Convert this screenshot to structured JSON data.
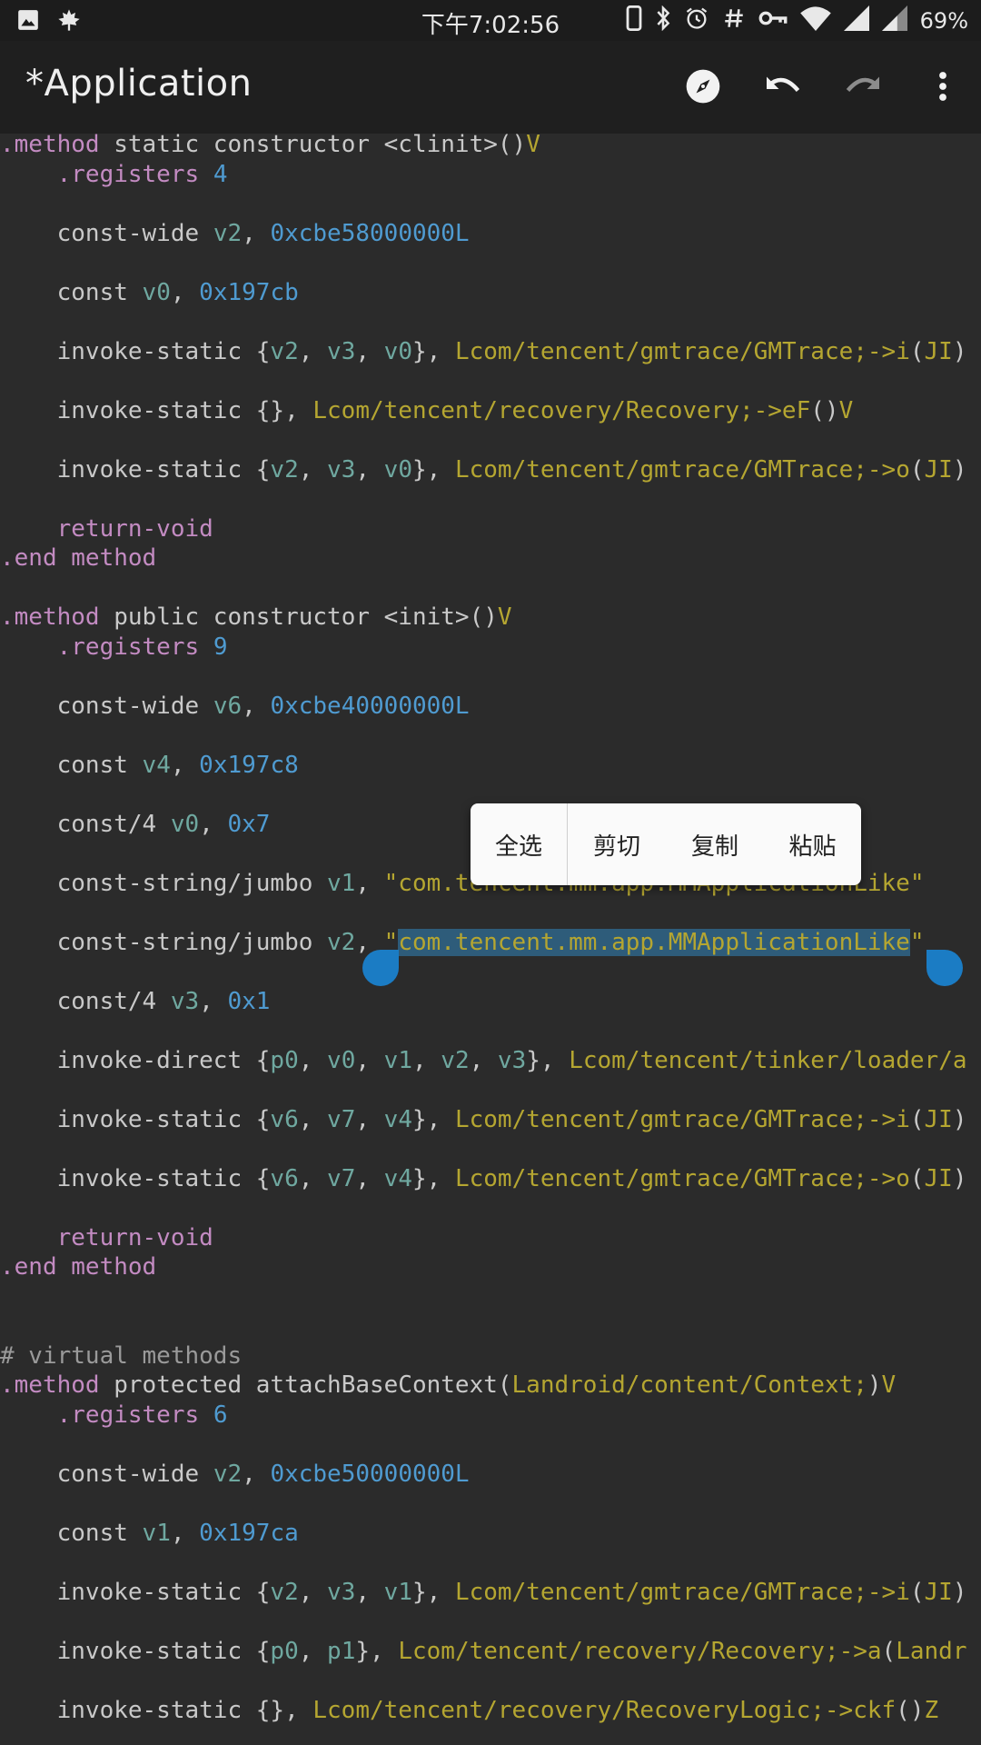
{
  "status_bar": {
    "time": "下午7:02:56",
    "battery": "69%",
    "left_icons": [
      "image-icon",
      "maple-leaf-icon"
    ],
    "right_icons": [
      "phone-icon",
      "bluetooth-icon",
      "alarm-icon",
      "hash-icon",
      "vpn-key-icon",
      "wifi-icon",
      "signal-icon",
      "signal-icon"
    ]
  },
  "app_bar": {
    "title": "*Application",
    "actions": [
      "compass-icon",
      "undo-icon",
      "redo-icon",
      "more-vert-icon"
    ]
  },
  "context_menu": {
    "items": [
      "全选",
      "剪切",
      "复制",
      "粘贴"
    ]
  },
  "code_lines": [
    [
      [
        ".method ",
        "kw"
      ],
      [
        "static constructor <clinit>()",
        "plain"
      ],
      [
        "V",
        "type"
      ]
    ],
    [
      [
        "    .registers ",
        "kw"
      ],
      [
        "4",
        "num"
      ]
    ],
    [],
    [
      [
        "    const-wide ",
        "plain"
      ],
      [
        "v2",
        "reg"
      ],
      [
        ", ",
        "plain"
      ],
      [
        "0xcbe58000000L",
        "num"
      ]
    ],
    [],
    [
      [
        "    const ",
        "plain"
      ],
      [
        "v0",
        "reg"
      ],
      [
        ", ",
        "plain"
      ],
      [
        "0x197cb",
        "num"
      ]
    ],
    [],
    [
      [
        "    invoke-static {",
        "plain"
      ],
      [
        "v2",
        "reg"
      ],
      [
        ", ",
        "plain"
      ],
      [
        "v3",
        "reg"
      ],
      [
        ", ",
        "plain"
      ],
      [
        "v0",
        "reg"
      ],
      [
        "}, ",
        "plain"
      ],
      [
        "Lcom/tencent/gmtrace/GMTrace;->i",
        "type"
      ],
      [
        "(",
        "plain"
      ],
      [
        "JI",
        "type"
      ],
      [
        ")",
        "plain"
      ]
    ],
    [],
    [
      [
        "    invoke-static {}, ",
        "plain"
      ],
      [
        "Lcom/tencent/recovery/Recovery;->eF",
        "type"
      ],
      [
        "()",
        "plain"
      ],
      [
        "V",
        "type"
      ]
    ],
    [],
    [
      [
        "    invoke-static {",
        "plain"
      ],
      [
        "v2",
        "reg"
      ],
      [
        ", ",
        "plain"
      ],
      [
        "v3",
        "reg"
      ],
      [
        ", ",
        "plain"
      ],
      [
        "v0",
        "reg"
      ],
      [
        "}, ",
        "plain"
      ],
      [
        "Lcom/tencent/gmtrace/GMTrace;->o",
        "type"
      ],
      [
        "(",
        "plain"
      ],
      [
        "JI",
        "type"
      ],
      [
        ")",
        "plain"
      ]
    ],
    [],
    [
      [
        "    return-void",
        "kw"
      ]
    ],
    [
      [
        ".end method",
        "kw"
      ]
    ],
    [],
    [
      [
        ".method ",
        "kw"
      ],
      [
        "public constructor <init>()",
        "plain"
      ],
      [
        "V",
        "type"
      ]
    ],
    [
      [
        "    .registers ",
        "kw"
      ],
      [
        "9",
        "num"
      ]
    ],
    [],
    [
      [
        "    const-wide ",
        "plain"
      ],
      [
        "v6",
        "reg"
      ],
      [
        ", ",
        "plain"
      ],
      [
        "0xcbe40000000L",
        "num"
      ]
    ],
    [],
    [
      [
        "    const ",
        "plain"
      ],
      [
        "v4",
        "reg"
      ],
      [
        ", ",
        "plain"
      ],
      [
        "0x197c8",
        "num"
      ]
    ],
    [],
    [
      [
        "    const/4 ",
        "plain"
      ],
      [
        "v0",
        "reg"
      ],
      [
        ", ",
        "plain"
      ],
      [
        "0x7",
        "num"
      ]
    ],
    [],
    [
      [
        "    const-string/jumbo ",
        "plain"
      ],
      [
        "v1",
        "reg"
      ],
      [
        ", ",
        "plain"
      ],
      [
        "\"com.tencent.mm.app.MMApplicationLike\"",
        "str"
      ]
    ],
    [],
    [
      [
        "    const-string/jumbo ",
        "plain"
      ],
      [
        "v2",
        "reg"
      ],
      [
        ", ",
        "plain"
      ],
      [
        "\"",
        "str"
      ],
      [
        "com.tencent.mm.app.MMApplicationLike",
        "str sel"
      ],
      [
        "\"",
        "str"
      ]
    ],
    [],
    [
      [
        "    const/4 ",
        "plain"
      ],
      [
        "v3",
        "reg"
      ],
      [
        ", ",
        "plain"
      ],
      [
        "0x1",
        "num"
      ]
    ],
    [],
    [
      [
        "    invoke-direct {",
        "plain"
      ],
      [
        "p0",
        "reg"
      ],
      [
        ", ",
        "plain"
      ],
      [
        "v0",
        "reg"
      ],
      [
        ", ",
        "plain"
      ],
      [
        "v1",
        "reg"
      ],
      [
        ", ",
        "plain"
      ],
      [
        "v2",
        "reg"
      ],
      [
        ", ",
        "plain"
      ],
      [
        "v3",
        "reg"
      ],
      [
        "}, ",
        "plain"
      ],
      [
        "Lcom/tencent/tinker/loader/a",
        "type"
      ]
    ],
    [],
    [
      [
        "    invoke-static {",
        "plain"
      ],
      [
        "v6",
        "reg"
      ],
      [
        ", ",
        "plain"
      ],
      [
        "v7",
        "reg"
      ],
      [
        ", ",
        "plain"
      ],
      [
        "v4",
        "reg"
      ],
      [
        "}, ",
        "plain"
      ],
      [
        "Lcom/tencent/gmtrace/GMTrace;->i",
        "type"
      ],
      [
        "(",
        "plain"
      ],
      [
        "JI",
        "type"
      ],
      [
        ")",
        "plain"
      ]
    ],
    [],
    [
      [
        "    invoke-static {",
        "plain"
      ],
      [
        "v6",
        "reg"
      ],
      [
        ", ",
        "plain"
      ],
      [
        "v7",
        "reg"
      ],
      [
        ", ",
        "plain"
      ],
      [
        "v4",
        "reg"
      ],
      [
        "}, ",
        "plain"
      ],
      [
        "Lcom/tencent/gmtrace/GMTrace;->o",
        "type"
      ],
      [
        "(",
        "plain"
      ],
      [
        "JI",
        "type"
      ],
      [
        ")",
        "plain"
      ]
    ],
    [],
    [
      [
        "    return-void",
        "kw"
      ]
    ],
    [
      [
        ".end method",
        "kw"
      ]
    ],
    [],
    [],
    [
      [
        "# virtual methods",
        "cmt"
      ]
    ],
    [
      [
        ".method ",
        "kw"
      ],
      [
        "protected attachBaseContext(",
        "plain"
      ],
      [
        "Landroid/content/Context;",
        "type"
      ],
      [
        ")",
        "plain"
      ],
      [
        "V",
        "type"
      ]
    ],
    [
      [
        "    .registers ",
        "kw"
      ],
      [
        "6",
        "num"
      ]
    ],
    [],
    [
      [
        "    const-wide ",
        "plain"
      ],
      [
        "v2",
        "reg"
      ],
      [
        ", ",
        "plain"
      ],
      [
        "0xcbe50000000L",
        "num"
      ]
    ],
    [],
    [
      [
        "    const ",
        "plain"
      ],
      [
        "v1",
        "reg"
      ],
      [
        ", ",
        "plain"
      ],
      [
        "0x197ca",
        "num"
      ]
    ],
    [],
    [
      [
        "    invoke-static {",
        "plain"
      ],
      [
        "v2",
        "reg"
      ],
      [
        ", ",
        "plain"
      ],
      [
        "v3",
        "reg"
      ],
      [
        ", ",
        "plain"
      ],
      [
        "v1",
        "reg"
      ],
      [
        "}, ",
        "plain"
      ],
      [
        "Lcom/tencent/gmtrace/GMTrace;->i",
        "type"
      ],
      [
        "(",
        "plain"
      ],
      [
        "JI",
        "type"
      ],
      [
        ")",
        "plain"
      ]
    ],
    [],
    [
      [
        "    invoke-static {",
        "plain"
      ],
      [
        "p0",
        "reg"
      ],
      [
        ", ",
        "plain"
      ],
      [
        "p1",
        "reg"
      ],
      [
        "}, ",
        "plain"
      ],
      [
        "Lcom/tencent/recovery/Recovery;->a",
        "type"
      ],
      [
        "(",
        "plain"
      ],
      [
        "Landr",
        "type"
      ]
    ],
    [],
    [
      [
        "    invoke-static {}, ",
        "plain"
      ],
      [
        "Lcom/tencent/recovery/RecoveryLogic;->ckf",
        "type"
      ],
      [
        "()",
        "plain"
      ],
      [
        "Z",
        "type"
      ]
    ]
  ]
}
